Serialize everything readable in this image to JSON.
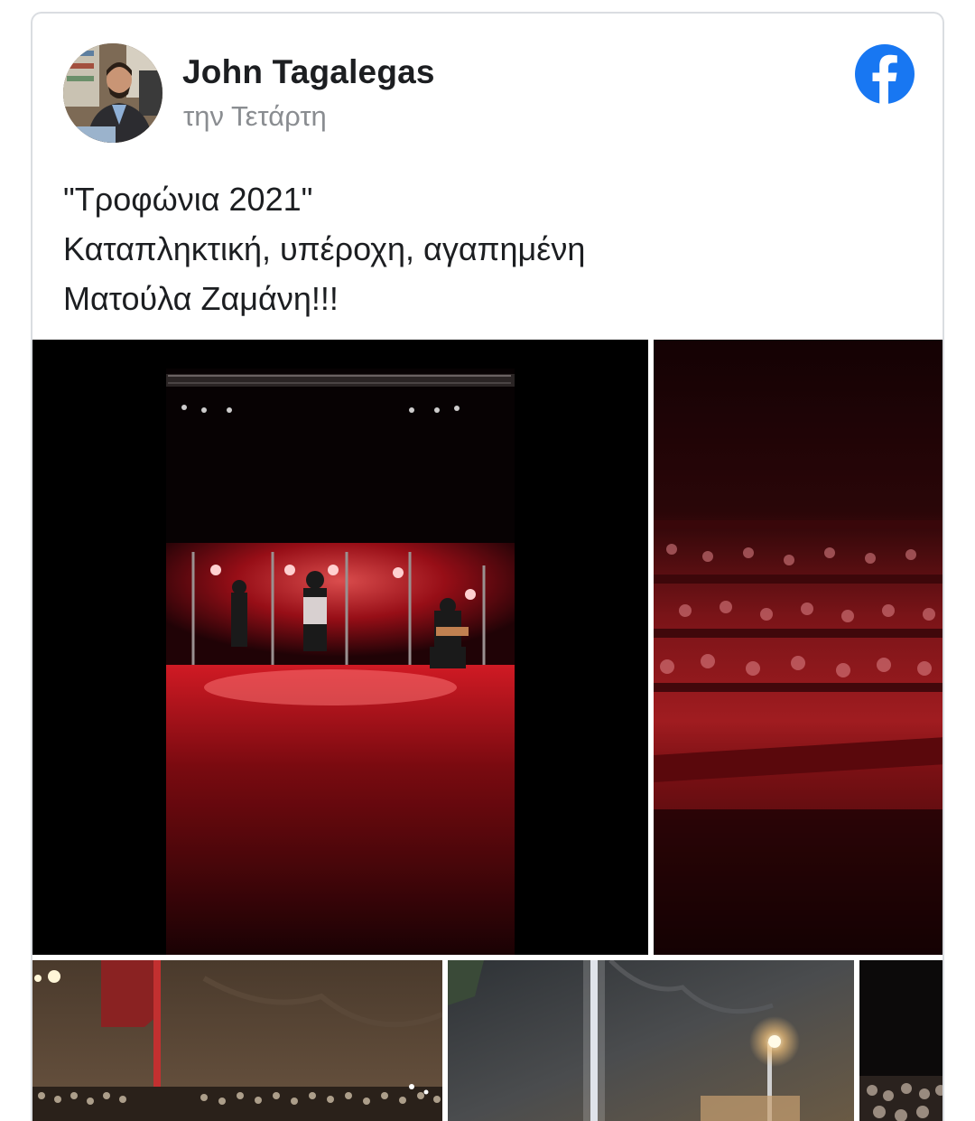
{
  "post": {
    "author_name": "John Tagalegas",
    "timestamp": "την Τετάρτη",
    "text_lines": [
      "\"Τροφώνια 2021\"",
      "Καταπληκτική, υπέροχη, αγαπημένη",
      "Ματούλα Ζαμάνη!!!"
    ]
  },
  "icons": {
    "brand": "facebook-icon",
    "avatar": "avatar"
  },
  "photos": [
    {
      "name": "concert-stage-photo"
    },
    {
      "name": "audience-red-light-photo"
    },
    {
      "name": "theater-crowd-rock-photo"
    },
    {
      "name": "rock-wall-streetlight-photo"
    },
    {
      "name": "night-crowd-photo"
    }
  ],
  "colors": {
    "facebook_blue": "#1877f2",
    "author_text": "#1c1e21",
    "timestamp_text": "#8a8d91",
    "card_border": "#dadde1"
  }
}
